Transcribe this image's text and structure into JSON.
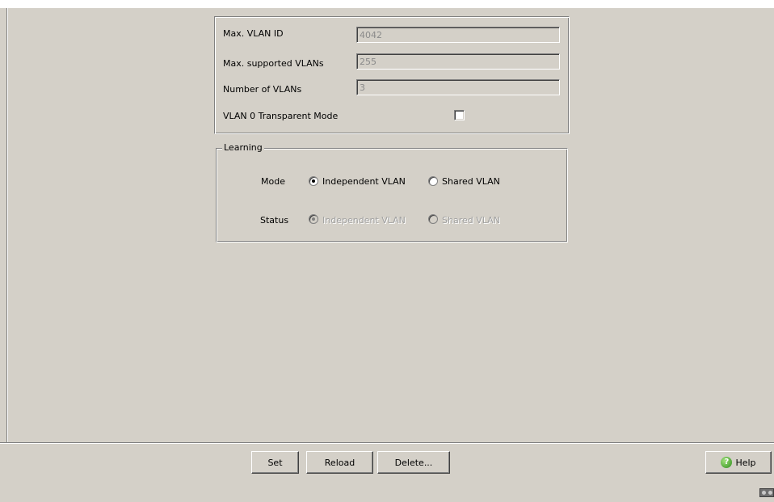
{
  "vlan_info": {
    "max_vlan_id_label": "Max. VLAN ID",
    "max_vlan_id_value": "4042",
    "max_supported_label": "Max. supported VLANs",
    "max_supported_value": "255",
    "number_of_vlans_label": "Number of VLANs",
    "number_of_vlans_value": "3",
    "transparent_mode_label": "VLAN 0 Transparent Mode",
    "transparent_mode_checked": false
  },
  "learning": {
    "legend": "Learning",
    "mode_label": "Mode",
    "mode_options": [
      "Independent VLAN",
      "Shared VLAN"
    ],
    "mode_selected": "Independent VLAN",
    "status_label": "Status",
    "status_options": [
      "Independent VLAN",
      "Shared VLAN"
    ],
    "status_selected": "Independent VLAN"
  },
  "buttons": {
    "set": "Set",
    "reload": "Reload",
    "delete": "Delete...",
    "help": "Help"
  },
  "icons": {
    "help": "help-icon",
    "corner": "connection-status-icon"
  },
  "colors": {
    "background": "#d4d0c8",
    "disabled_text": "#a0a0a0"
  }
}
